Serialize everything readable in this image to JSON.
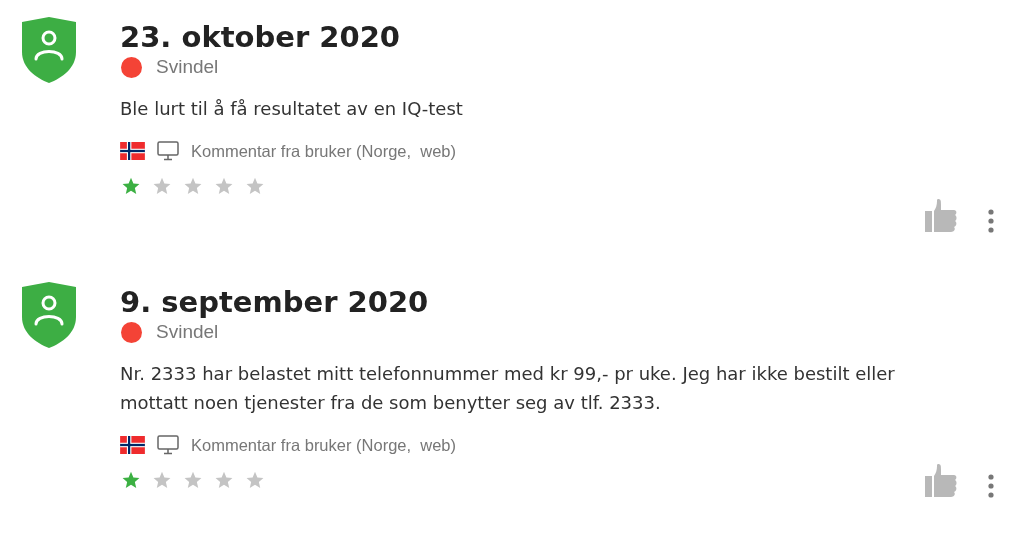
{
  "comments": [
    {
      "date": "23. oktober 2020",
      "category": {
        "label": "Svindel",
        "color": "#f44336"
      },
      "text": "Ble lurt til å få resultatet av en IQ-test",
      "source": "Kommentar fra bruker (Norge,  web)",
      "stars": 1
    },
    {
      "date": "9. september 2020",
      "category": {
        "label": "Svindel",
        "color": "#f44336"
      },
      "text": "Nr. 2333 har belastet mitt telefonnummer med kr 99,- pr uke. Jeg har ikke bestilt eller mottatt noen tjenester fra de som benytter seg av tlf. 2333.",
      "source": "Kommentar fra bruker (Norge,  web)",
      "stars": 1
    }
  ]
}
